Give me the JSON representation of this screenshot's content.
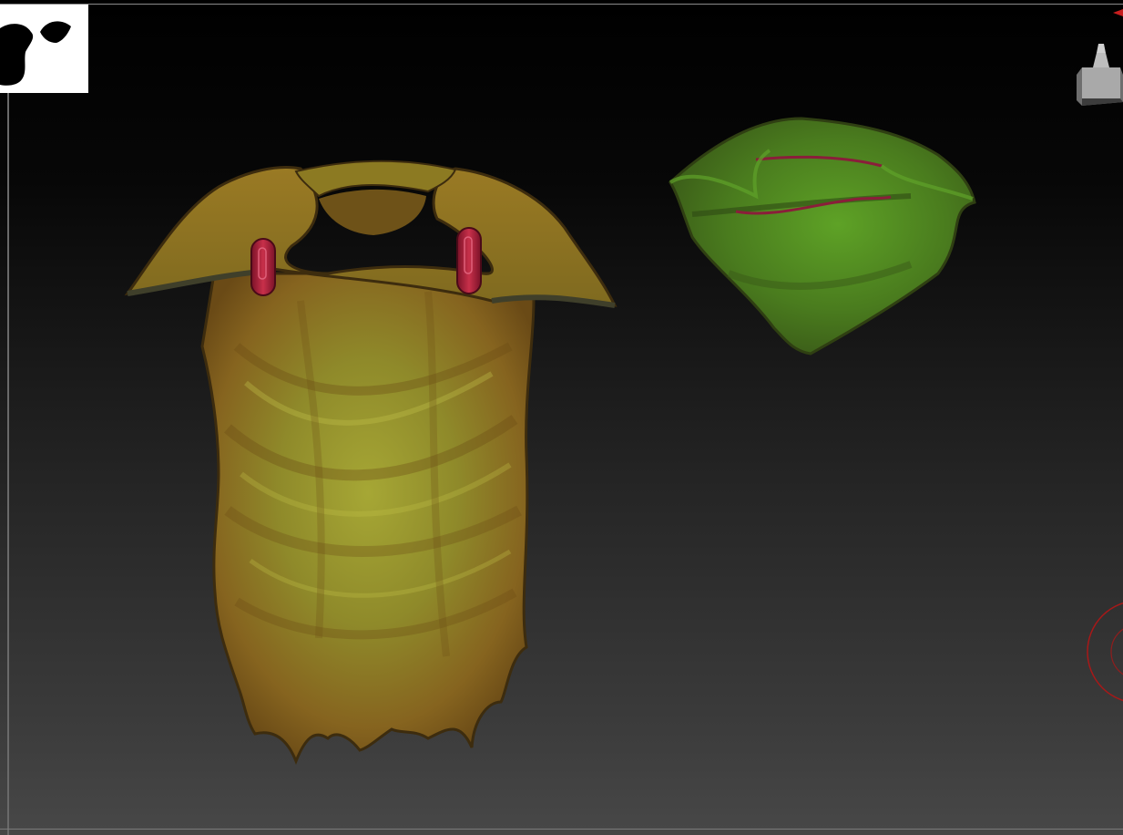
{
  "viewport": {
    "background_top": "#000000",
    "background_bottom": "#474747"
  },
  "scene": {
    "objects": [
      {
        "name": "tunic-mesh",
        "material_color": "#8a8a2a",
        "shadow_color": "#7a4a18"
      },
      {
        "name": "cowl-mesh",
        "material_color": "#4f8a22"
      }
    ],
    "clasp_color": "#a01e3a"
  },
  "icons": {
    "thumbnail": "silhouette-thumbnail-icon",
    "nav_cube": "navigation-cube-icon",
    "gizmo": "rotation-gizmo-icon"
  }
}
